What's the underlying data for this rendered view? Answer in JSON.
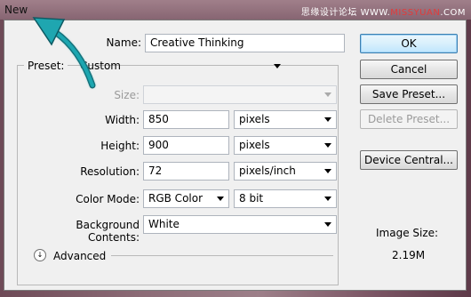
{
  "window": {
    "title": "New"
  },
  "watermark": {
    "cn": "思缘设计论坛",
    "site_prefix": "WWW.",
    "site_red": "MISSYUAN",
    "site_suffix": ".COM"
  },
  "form": {
    "name_label": "Name:",
    "name_value": "Creative Thinking",
    "preset_label": "Preset:",
    "preset_value": "Custom",
    "size_label": "Size:",
    "size_value": "",
    "width_label": "Width:",
    "width_value": "850",
    "width_unit": "pixels",
    "height_label": "Height:",
    "height_value": "900",
    "height_unit": "pixels",
    "resolution_label": "Resolution:",
    "resolution_value": "72",
    "resolution_unit": "pixels/inch",
    "color_mode_label": "Color Mode:",
    "color_mode_value": "RGB Color",
    "bit_depth_value": "8 bit",
    "background_label": "Background Contents:",
    "background_value": "White",
    "advanced_label": "Advanced"
  },
  "buttons": {
    "ok": "OK",
    "cancel": "Cancel",
    "save_preset": "Save Preset...",
    "delete_preset": "Delete Preset...",
    "device_central": "Device Central..."
  },
  "image_size": {
    "label": "Image Size:",
    "value": "2.19M"
  },
  "icons": {
    "annotation": "teal-curved-arrow-icon",
    "advanced": "double-chevron-down-icon"
  },
  "colors": {
    "arrow": "#1fa6b0",
    "default_button_border": "#3c7fb1"
  }
}
